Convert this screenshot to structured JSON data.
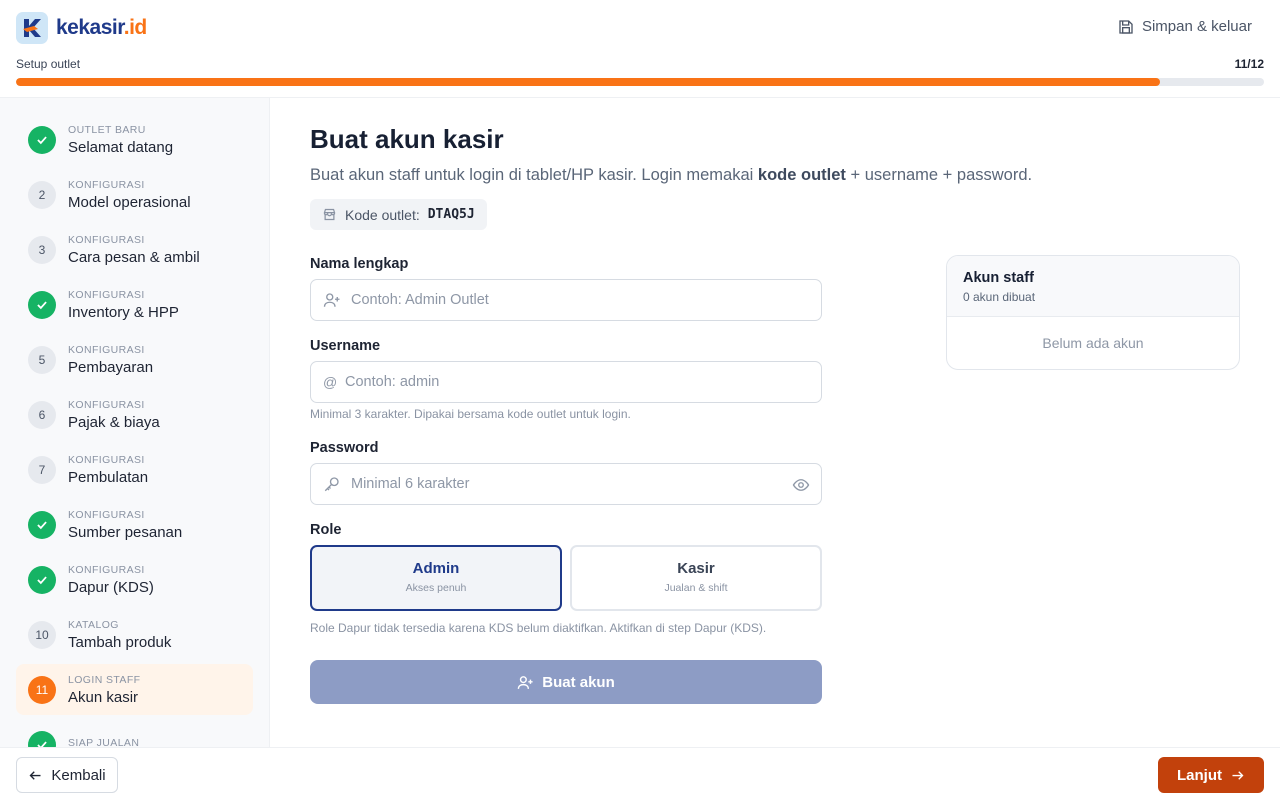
{
  "header": {
    "brand_main": "kekasir",
    "brand_dot": ".id",
    "save_exit_label": "Simpan & keluar",
    "progress_label": "Setup outlet",
    "progress_count": "11/12",
    "progress_fraction": 0.917,
    "accent_color": "#f97316",
    "brand_color": "#1f3a8a"
  },
  "sidebar": {
    "steps": [
      {
        "category": "OUTLET BARU",
        "title": "Selamat datang",
        "marker": "",
        "state": "done"
      },
      {
        "category": "KONFIGURASI",
        "title": "Model operasional",
        "marker": "2",
        "state": "pending"
      },
      {
        "category": "KONFIGURASI",
        "title": "Cara pesan & ambil",
        "marker": "3",
        "state": "pending"
      },
      {
        "category": "KONFIGURASI",
        "title": "Inventory & HPP",
        "marker": "",
        "state": "done"
      },
      {
        "category": "KONFIGURASI",
        "title": "Pembayaran",
        "marker": "5",
        "state": "pending"
      },
      {
        "category": "KONFIGURASI",
        "title": "Pajak & biaya",
        "marker": "6",
        "state": "pending"
      },
      {
        "category": "KONFIGURASI",
        "title": "Pembulatan",
        "marker": "7",
        "state": "pending"
      },
      {
        "category": "KONFIGURASI",
        "title": "Sumber pesanan",
        "marker": "",
        "state": "done"
      },
      {
        "category": "KONFIGURASI",
        "title": "Dapur (KDS)",
        "marker": "",
        "state": "done"
      },
      {
        "category": "KATALOG",
        "title": "Tambah produk",
        "marker": "10",
        "state": "pending"
      },
      {
        "category": "LOGIN STAFF",
        "title": "Akun kasir",
        "marker": "11",
        "state": "current"
      },
      {
        "category": "SIAP JUALAN",
        "title": "",
        "marker": "",
        "state": "done"
      }
    ]
  },
  "main": {
    "title": "Buat akun kasir",
    "desc_pre": "Buat akun staff untuk login di tablet/HP kasir. Login memakai ",
    "desc_bold": "kode outlet",
    "desc_post": " + username + password.",
    "outlet_code_label": "Kode outlet:",
    "outlet_code_value": "DTAQ5J",
    "name_label": "Nama lengkap",
    "name_placeholder": "Contoh: Admin Outlet",
    "username_label": "Username",
    "username_prefix": "@",
    "username_placeholder": "Contoh: admin",
    "username_hint": "Minimal 3 karakter. Dipakai bersama kode outlet untuk login.",
    "password_label": "Password",
    "password_placeholder": "Minimal 6 karakter",
    "role_label": "Role",
    "roles": [
      {
        "name": "Admin",
        "sub": "Akses penuh",
        "selected": true
      },
      {
        "name": "Kasir",
        "sub": "Jualan & shift",
        "selected": false
      }
    ],
    "role_hint": "Role Dapur tidak tersedia karena KDS belum diaktifkan. Aktifkan di step Dapur (KDS).",
    "create_button": "Buat akun"
  },
  "staff_panel": {
    "title": "Akun staff",
    "count": "0 akun dibuat",
    "empty": "Belum ada akun"
  },
  "footer": {
    "back_label": "Kembali",
    "next_label": "Lanjut"
  }
}
